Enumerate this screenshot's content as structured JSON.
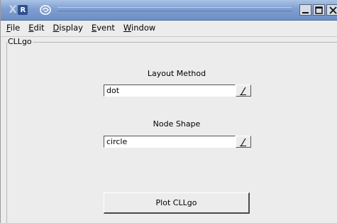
{
  "window": {
    "app_badge": "R",
    "x_logo": "X"
  },
  "menu": [
    {
      "label": "File"
    },
    {
      "label": "Edit"
    },
    {
      "label": "Display"
    },
    {
      "label": "Event"
    },
    {
      "label": "Window"
    }
  ],
  "group": {
    "title": "CLLgo"
  },
  "layout_method": {
    "label": "Layout Method",
    "value": "dot"
  },
  "node_shape": {
    "label": "Node Shape",
    "value": "circle"
  },
  "plot_button": {
    "label": "Plot CLLgo"
  },
  "icons": [
    "x-logo-icon",
    "r-app-icon",
    "swirl-menu-icon",
    "minimize-icon",
    "maximize-icon",
    "close-icon",
    "dropdown-arrow-icon"
  ],
  "colors": {
    "titlebar": "#7f9ed0",
    "window_bg": "#ececec"
  }
}
